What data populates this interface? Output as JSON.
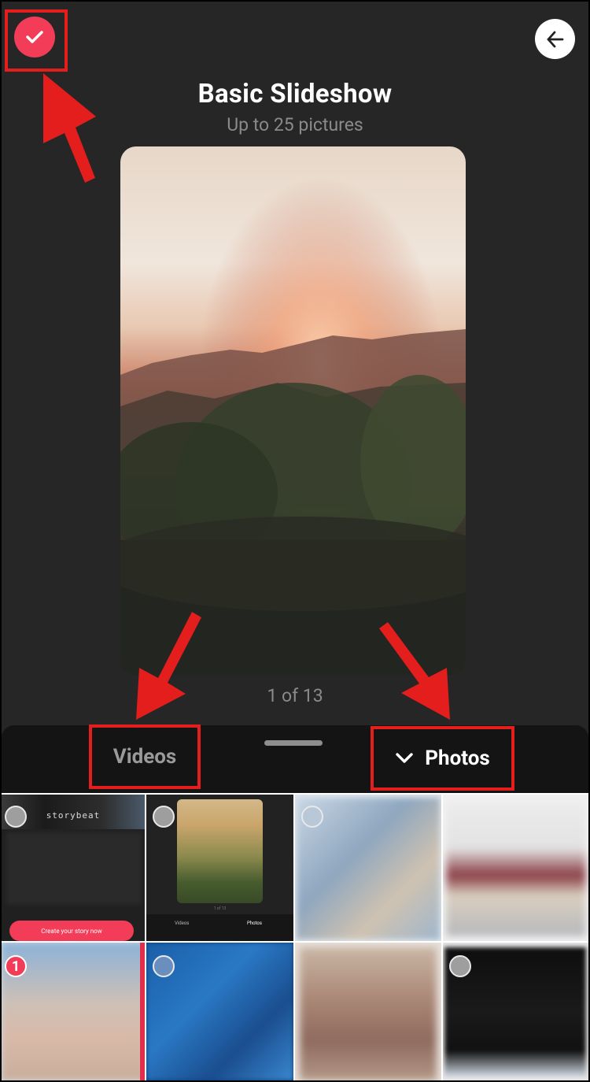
{
  "header": {
    "title": "Basic Slideshow",
    "subtitle": "Up to 25 pictures"
  },
  "preview": {
    "counter": "1 of 13"
  },
  "tabs": {
    "videos": "Videos",
    "photos": "Photos"
  },
  "gallery": {
    "items": [
      {
        "brand": "storybeat",
        "cta": "Create your story now"
      },
      {
        "counter": "1 of 13",
        "tab_videos": "Videos",
        "tab_photos": "Photos"
      },
      {},
      {},
      {
        "selected_index": "1"
      },
      {},
      {},
      {}
    ]
  },
  "colors": {
    "accent": "#f23c58",
    "background": "#262626",
    "sheet": "#141414",
    "annotation": "#e41d1d"
  }
}
